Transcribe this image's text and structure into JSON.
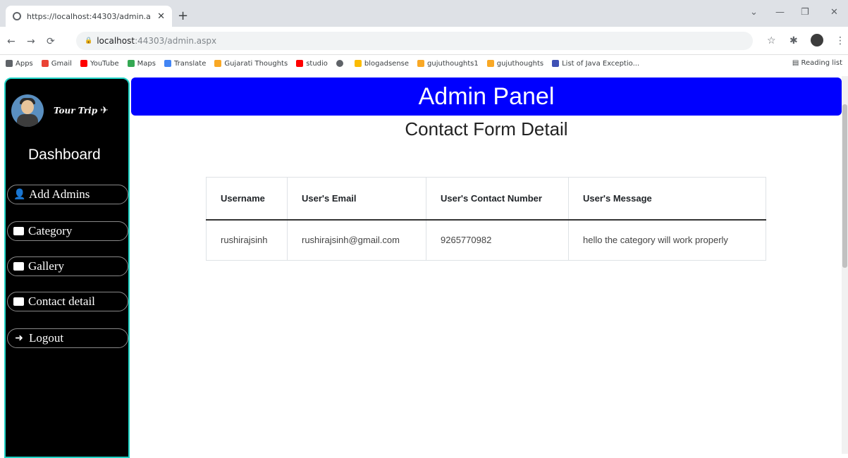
{
  "browser": {
    "tab_title": "https://localhost:44303/admin.a",
    "url_host": "localhost",
    "url_path": ":44303/admin.aspx",
    "bookmarks": [
      "Apps",
      "Gmail",
      "YouTube",
      "Maps",
      "Translate",
      "Gujarati Thoughts",
      "studio",
      "",
      "blogadsense",
      "gujuthoughts1",
      "gujuthoughts",
      "List of Java Exceptio..."
    ],
    "reading_list": "Reading list"
  },
  "sidebar": {
    "brand": "Tour Trip",
    "title": "Dashboard",
    "items": [
      {
        "label": "Add Admins",
        "icon": "user-icon"
      },
      {
        "label": "Category",
        "icon": "category-icon"
      },
      {
        "label": "Gallery",
        "icon": "image-icon"
      },
      {
        "label": "Contact detail",
        "icon": "contact-icon"
      },
      {
        "label": "Logout",
        "icon": "logout-icon"
      }
    ]
  },
  "header": {
    "title": "Admin Panel"
  },
  "main": {
    "section_title": "Contact Form Detail",
    "table": {
      "columns": [
        "Username",
        "User's Email",
        "User's Contact Number",
        "User's Message"
      ],
      "rows": [
        [
          "rushirajsinh",
          "rushirajsinh@gmail.com",
          "9265770982",
          "hello the category will work properly"
        ]
      ]
    }
  },
  "colors": {
    "header": "#0000ff",
    "sidebar": "#000000",
    "sidebar_border": "#1fd3c6"
  }
}
